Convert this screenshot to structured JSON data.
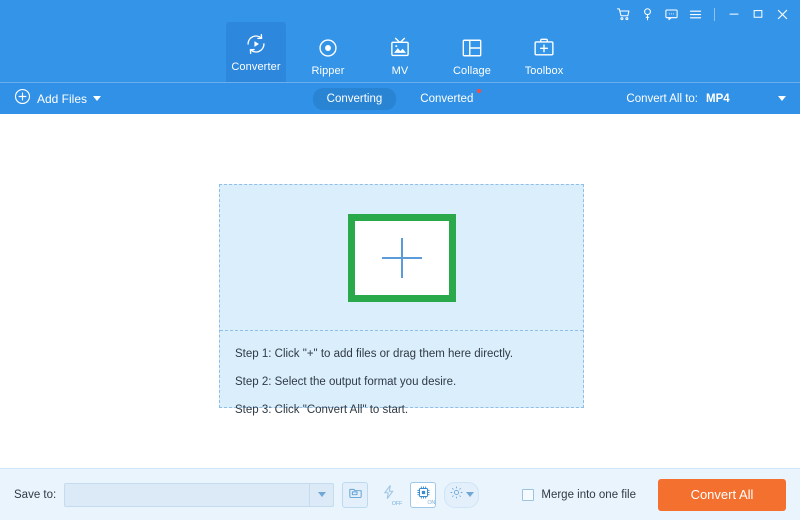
{
  "window": {
    "controls": [
      {
        "name": "cart-icon",
        "title": "Shop"
      },
      {
        "name": "key-icon",
        "title": "Register"
      },
      {
        "name": "feedback-icon",
        "title": "Feedback"
      },
      {
        "name": "menu-icon",
        "title": "Menu"
      },
      {
        "name": "minimize-icon",
        "title": "Minimize"
      },
      {
        "name": "maximize-icon",
        "title": "Maximize"
      },
      {
        "name": "close-icon",
        "title": "Close"
      }
    ]
  },
  "nav": {
    "items": [
      {
        "label": "Converter",
        "icon": "converter-icon",
        "active": true
      },
      {
        "label": "Ripper",
        "icon": "ripper-icon",
        "active": false
      },
      {
        "label": "MV",
        "icon": "mv-icon",
        "active": false
      },
      {
        "label": "Collage",
        "icon": "collage-icon",
        "active": false
      },
      {
        "label": "Toolbox",
        "icon": "toolbox-icon",
        "active": false
      }
    ]
  },
  "toolbar": {
    "add_files_label": "Add Files",
    "tabs": [
      {
        "label": "Converting",
        "active": true,
        "badge": false
      },
      {
        "label": "Converted",
        "active": false,
        "badge": true
      }
    ],
    "convert_all_to_label": "Convert All to:",
    "convert_all_to_value": "MP4"
  },
  "dropzone": {
    "plus_glyph": "+",
    "steps": [
      "Step 1: Click \"+\" to add files or drag them here directly.",
      "Step 2: Select the output format you desire.",
      "Step 3: Click \"Convert All\" to start."
    ]
  },
  "footer": {
    "save_to_label": "Save to:",
    "save_to_value": "",
    "save_to_placeholder": "",
    "tools": [
      {
        "name": "open-folder-icon",
        "state": ""
      },
      {
        "name": "high-speed-conversion-icon",
        "state": "OFF"
      },
      {
        "name": "gpu-acceleration-icon",
        "state": "ON"
      },
      {
        "name": "preferences-gear-icon",
        "state": ""
      }
    ],
    "merge_label": "Merge into one file",
    "merge_checked": false,
    "convert_all_label": "Convert All"
  },
  "colors": {
    "header_blue": "#3494e8",
    "toolbar_blue": "#3191e6",
    "active_tab_blue": "#2a84d4",
    "dropzone_fill": "#dbeefc",
    "dropzone_border": "#8fbfe6",
    "plus_box_green": "#2aa94a",
    "plus_glyph_blue": "#5b9bd8",
    "footer_bg": "#e9f4fd",
    "convert_all_orange": "#f4702f",
    "badge_red": "#ff4b3e"
  }
}
